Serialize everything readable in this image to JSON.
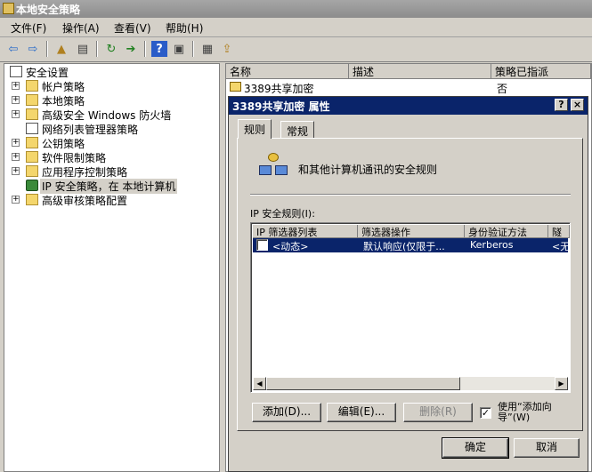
{
  "window": {
    "title": "本地安全策略"
  },
  "menubar": {
    "items": [
      "文件(F)",
      "操作(A)",
      "查看(V)",
      "帮助(H)"
    ]
  },
  "toolbar": {
    "icons": [
      "back-icon",
      "forward-icon",
      "up-folder-icon",
      "show-tree-icon",
      "refresh-icon",
      "export-icon",
      "help-icon",
      "console-icon",
      "properties-icon",
      "assign-icon"
    ]
  },
  "tree": {
    "root": "安全设置",
    "items": [
      {
        "label": "帐户策略",
        "expandable": true
      },
      {
        "label": "本地策略",
        "expandable": true
      },
      {
        "label": "高级安全 Windows 防火墙",
        "expandable": true
      },
      {
        "label": "网络列表管理器策略",
        "expandable": false
      },
      {
        "label": "公钥策略",
        "expandable": true
      },
      {
        "label": "软件限制策略",
        "expandable": true
      },
      {
        "label": "应用程序控制策略",
        "expandable": true
      },
      {
        "label": "IP 安全策略，在 本地计算机",
        "expandable": false,
        "selected": true
      },
      {
        "label": "高级审核策略配置",
        "expandable": true
      }
    ]
  },
  "list": {
    "columns": [
      "名称",
      "描述",
      "策略已指派"
    ],
    "rows": [
      {
        "name": "3389共享加密",
        "description": "",
        "assigned": "否"
      }
    ]
  },
  "dialog": {
    "title": "3389共享加密 属性",
    "help_btn": "?",
    "close_btn": "×",
    "tabs": [
      "规则",
      "常规"
    ],
    "description": "和其他计算机通讯的安全规则",
    "rules_label": "IP 安全规则(I):",
    "rules_columns": [
      "IP 筛选器列表",
      "筛选器操作",
      "身份验证方法",
      "隧"
    ],
    "rules_rows": [
      {
        "checked": false,
        "filter_list": "<动态>",
        "filter_action": "默认响应(仅限于...",
        "auth": "Kerberos",
        "tunnel": "<无"
      }
    ],
    "buttons": {
      "add": "添加(D)...",
      "edit": "编辑(E)...",
      "remove": "删除(R)"
    },
    "use_wizard": {
      "checked": true,
      "label": "使用“添加向导”(W)"
    },
    "ok": "确定",
    "cancel": "取消"
  }
}
